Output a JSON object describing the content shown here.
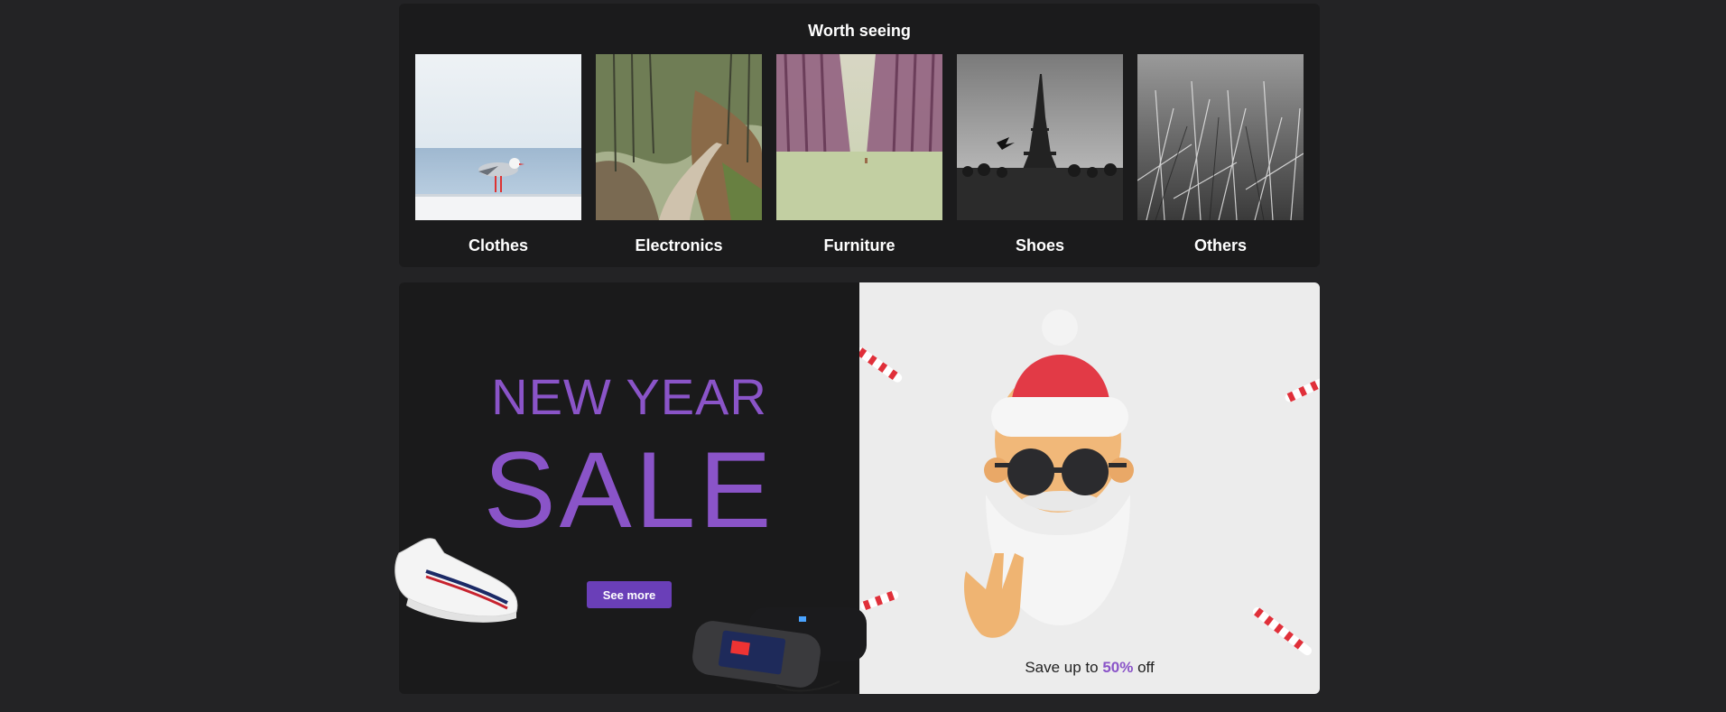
{
  "worth_seeing": {
    "title": "Worth seeing",
    "categories": [
      {
        "label": "Clothes",
        "image": "seagull-photo"
      },
      {
        "label": "Electronics",
        "image": "forest-path-photo"
      },
      {
        "label": "Furniture",
        "image": "tree-alley-photo"
      },
      {
        "label": "Shoes",
        "image": "eiffel-tower-photo"
      },
      {
        "label": "Others",
        "image": "grass-photo"
      }
    ]
  },
  "promo": {
    "headline": "NEW YEAR",
    "subheadline": "SALE",
    "cta_label": "See more",
    "save_prefix": "Save up to ",
    "save_percent": "50%",
    "save_suffix": " off",
    "colors": {
      "accent": "#8a54c8",
      "button": "#6a3fb8"
    }
  }
}
